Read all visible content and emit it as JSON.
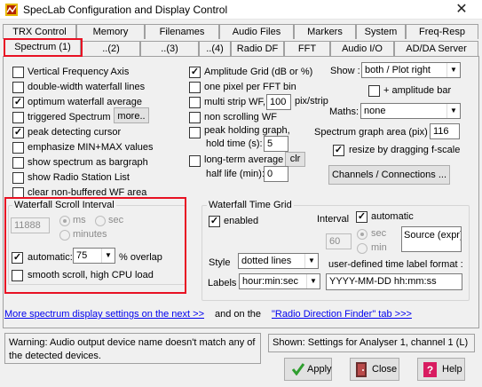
{
  "window": {
    "title": "SpecLab   Configuration and Display Control",
    "close_symbol": "✕"
  },
  "tabs_row1": [
    {
      "label": "TRX Control"
    },
    {
      "label": "Memory"
    },
    {
      "label": "Filenames"
    },
    {
      "label": "Audio Files"
    },
    {
      "label": "Markers"
    },
    {
      "label": "System"
    },
    {
      "label": "Freq-Resp"
    }
  ],
  "tabs_row2": [
    {
      "label": "Spectrum (1)"
    },
    {
      "label": "..(2)"
    },
    {
      "label": "..(3)"
    },
    {
      "label": "..(4)"
    },
    {
      "label": "Radio DF"
    },
    {
      "label": "FFT"
    },
    {
      "label": "Audio I/O"
    },
    {
      "label": "AD/DA Server"
    }
  ],
  "left_options": [
    {
      "label": "Vertical Frequency Axis",
      "checked": false
    },
    {
      "label": "double-width waterfall lines",
      "checked": false
    },
    {
      "label": "optimum waterfall average",
      "checked": true
    },
    {
      "label": "triggered Spectrum",
      "checked": false
    },
    {
      "label": "peak detecting cursor",
      "checked": true
    },
    {
      "label": "emphasize MIN+MAX values",
      "checked": false
    },
    {
      "label": "show spectrum as bargraph",
      "checked": false
    },
    {
      "label": "show Radio Station List",
      "checked": false
    },
    {
      "label": "clear non-buffered WF area",
      "checked": false
    }
  ],
  "more_button": "more..",
  "mid_options": {
    "amplitude_grid": {
      "label": "Amplitude Grid (dB or %)",
      "checked": true
    },
    "one_pixel": {
      "label": "one pixel per FFT bin",
      "checked": false
    },
    "multi_strip": {
      "label": "multi strip WF,",
      "checked": false,
      "value": "100",
      "unit": "pix/strip"
    },
    "non_scrolling": {
      "label": "non scrolling WF",
      "checked": false
    },
    "peak_holding": {
      "label": "peak holding graph,",
      "checked": false
    },
    "hold_time": {
      "label": "hold time (s):",
      "value": "5"
    },
    "long_term": {
      "label": "long-term average",
      "checked": false,
      "clr": "clr"
    },
    "half_life": {
      "label": "half life (min):",
      "value": "0"
    }
  },
  "right_options": {
    "show_label": "Show :",
    "show_value": "both / Plot  right",
    "amplitude_bar": {
      "label": "+ amplitude bar",
      "checked": false
    },
    "maths_label": "Maths:",
    "maths_value": "none",
    "graph_area_label": "Spectrum graph area (pix)",
    "graph_area_value": "116",
    "resize": {
      "label": "resize by dragging f-scale",
      "checked": true
    },
    "channels_button": "Channels / Connections ..."
  },
  "waterfall_scroll": {
    "title": "Waterfall Scroll Interval",
    "interval_value": "11888",
    "radio_ms": "ms",
    "radio_sec": "sec",
    "radio_minutes": "minutes",
    "automatic": {
      "label": "automatic:",
      "checked": true
    },
    "overlap_value": "75",
    "overlap_label": "% overlap",
    "smooth": {
      "label": "smooth scroll, high CPU load",
      "checked": false
    }
  },
  "waterfall_grid": {
    "title": "Waterfall Time Grid",
    "enabled": {
      "label": "enabled",
      "checked": true
    },
    "interval_label": "Interval",
    "automatic": {
      "label": "automatic",
      "checked": true
    },
    "interval_value": "60",
    "radio_sec": "sec",
    "radio_min": "min",
    "source_label": "Source (expr)",
    "style_label": "Style",
    "style_value": "dotted lines",
    "format_label": "user-defined time label format :",
    "labels_label": "Labels",
    "labels_value": "hour:min:sec",
    "format_value": "YYYY-MM-DD hh:mm:ss"
  },
  "links": {
    "more_settings": "More spectrum display settings on the next >>",
    "and_on_the": "and on the",
    "radio_df": "\"Radio Direction Finder\" tab  >>>"
  },
  "status": {
    "warning": "Warning: Audio output device name doesn't match any of the detected devices.",
    "shown": "Shown: Settings for Analyser 1, channel 1 (L)"
  },
  "buttons": {
    "apply": "Apply",
    "close": "Close",
    "help": "Help"
  },
  "colors": {
    "highlight": "#e81123",
    "link": "#0000ee",
    "apply_icon": "#2e9e2e"
  }
}
